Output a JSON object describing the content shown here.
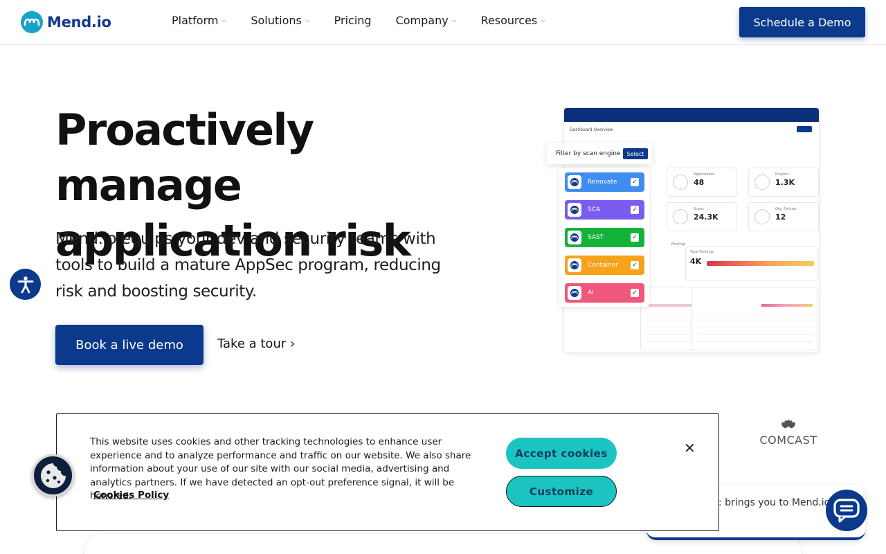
{
  "brand": {
    "name": "Mend.io",
    "primary": "#0b3a8c",
    "accent": "#1bc4c1"
  },
  "nav": {
    "items": [
      {
        "label": "Platform",
        "dropdown": true
      },
      {
        "label": "Solutions",
        "dropdown": true
      },
      {
        "label": "Pricing",
        "dropdown": false
      },
      {
        "label": "Company",
        "dropdown": true
      },
      {
        "label": "Resources",
        "dropdown": true
      }
    ],
    "cta": "Schedule a Demo"
  },
  "hero": {
    "title_bold": "Proactively",
    "title_rest": " manage application risk",
    "subtitle": "Mend.io equips your dev and security teams with tools to build a mature AppSec program, reducing risk and boosting security.",
    "primary_button": "Book a live demo",
    "secondary_link": "Take a tour",
    "secondary_chevron": "›"
  },
  "dashboard": {
    "title": "Dashboard Overview",
    "filter_title": "Filter by scan engine",
    "filter_button": "Select",
    "engines": [
      {
        "name": "Renovate",
        "color": "#3f8df0"
      },
      {
        "name": "SCA",
        "color": "#7a5cf0"
      },
      {
        "name": "SAST",
        "color": "#13b33a"
      },
      {
        "name": "Container",
        "color": "#f6a21a"
      },
      {
        "name": "AI",
        "color": "#f0577a"
      }
    ],
    "stats": [
      {
        "label": "Applications",
        "value": "48"
      },
      {
        "label": "Projects",
        "value": "1.3K"
      },
      {
        "label": "Scans",
        "value": "24.3K"
      },
      {
        "label": "Org. Policies",
        "value": "12"
      }
    ],
    "findings_label": "Findings",
    "total_findings_label": "Total Findings",
    "total_findings": "4K"
  },
  "logos": {
    "comcast": "COMCAST"
  },
  "chat": {
    "text": ": brings you to Mend.io"
  },
  "cookie": {
    "text": "This website uses cookies and other tracking technologies to enhance user experience and to analyze performance and traffic on our website. We also share information about your use of our site with our social media, advertising and analytics partners. If we have detected an opt-out preference signal, it will be honored.",
    "policy_link": "Cookies Policy",
    "accept": "Accept cookies",
    "customize": "Customize",
    "close_glyph": "✕"
  }
}
